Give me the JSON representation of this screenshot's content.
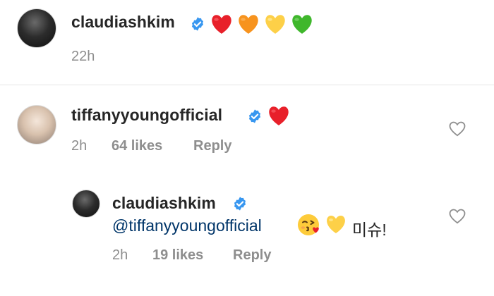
{
  "post": {
    "username": "claudiashkim",
    "verified": true,
    "caption_emoji": [
      "red-heart",
      "orange-heart",
      "yellow-heart",
      "green-heart"
    ],
    "time": "22h"
  },
  "comments": [
    {
      "username": "tiffanyyoungofficial",
      "verified": true,
      "emoji": [
        "red-heart"
      ],
      "time": "2h",
      "likes": "64 likes",
      "reply_label": "Reply"
    }
  ],
  "replies": [
    {
      "username": "claudiashkim",
      "verified": true,
      "mention": "@tiffanyyoungofficial",
      "emoji": [
        "kissing-face-with-heart",
        "yellow-heart"
      ],
      "text": "미슈!",
      "time": "2h",
      "likes": "19 likes",
      "reply_label": "Reply"
    }
  ],
  "colors": {
    "text": "#262626",
    "meta": "#8e8e8e",
    "mention": "#003569",
    "verified": "#3897f0",
    "red_heart": "#e8202a",
    "orange_heart": "#f7931e",
    "yellow_heart": "#fdd048",
    "green_heart": "#3fb72c"
  }
}
